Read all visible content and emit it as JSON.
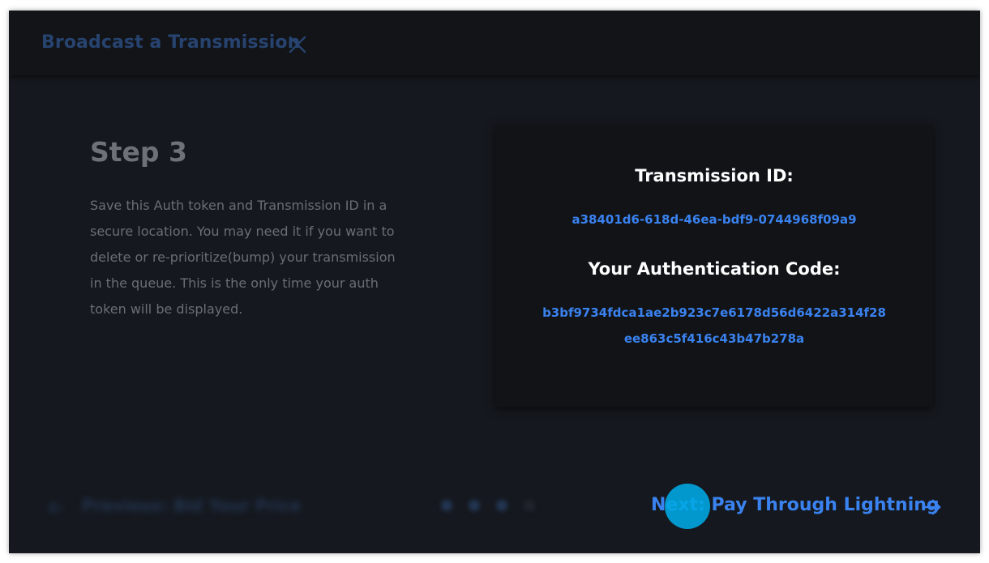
{
  "header": {
    "title": "Broadcast a Transmission",
    "close_icon": "close-icon"
  },
  "step": {
    "title": "Step 3",
    "description": "Save this Auth token and Transmission ID in a secure location. You may need it if you want to delete or re-prioritize(bump) your transmission in the queue. This is the only time your auth token will be displayed."
  },
  "card": {
    "transmission_id_label": "Transmission ID:",
    "transmission_id": "a38401d6-618d-46ea-bdf9-0744968f09a9",
    "auth_code_label": "Your Authentication Code:",
    "auth_code_line1": "b3bf9734fdca1ae2b923c7e6178d56d6422a314f28",
    "auth_code_line2": "ee863c5f416c43b47b278a"
  },
  "footer": {
    "previous_label": "Previous: Bid Your Price",
    "next_label": "Next: Pay Through Lightning",
    "step_dots": {
      "total": 4,
      "completed": 3
    }
  },
  "colors": {
    "accent": "#3a82ef",
    "header_title": "#27436f",
    "background": "#15181e",
    "card_background": "#111317",
    "click_indicator": "#00aae6"
  }
}
